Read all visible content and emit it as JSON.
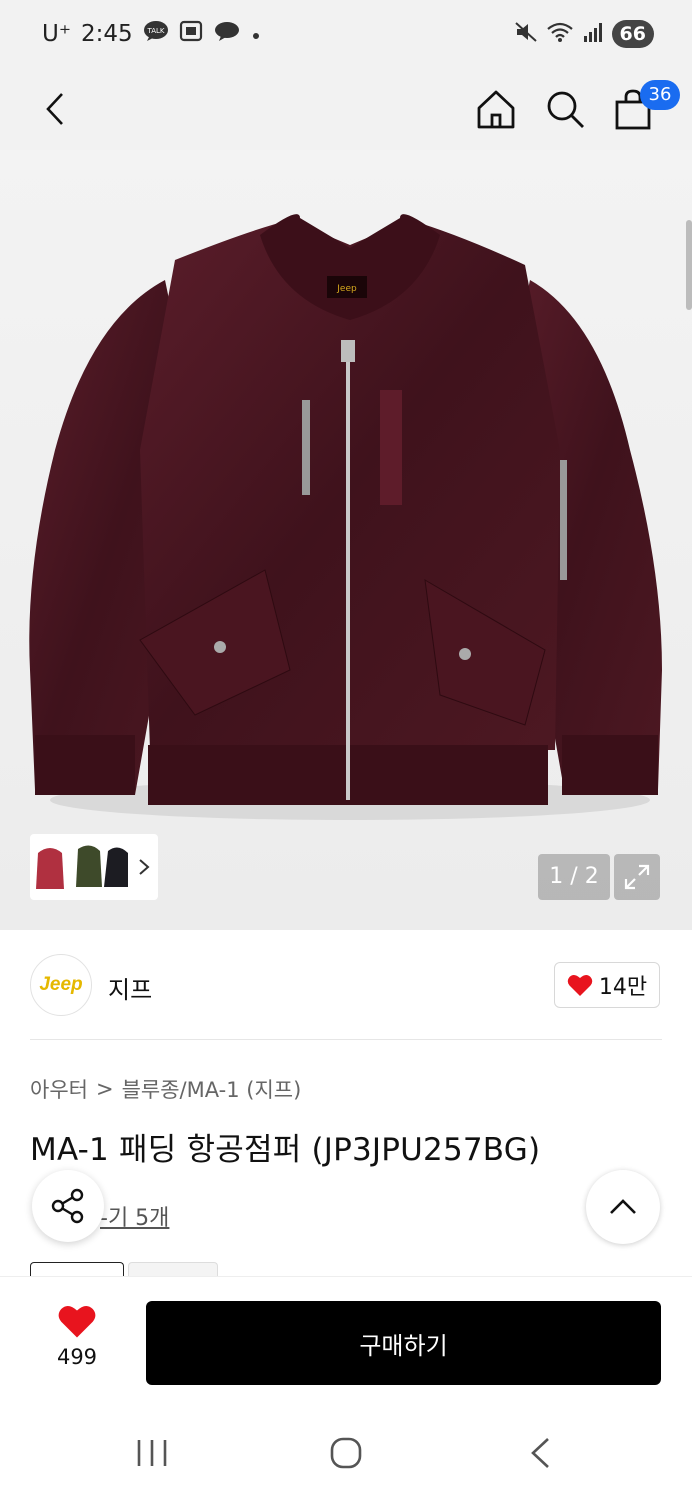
{
  "status_bar": {
    "carrier": "U⁺",
    "time": "2:45",
    "battery": "66"
  },
  "header": {
    "cart_count": "36"
  },
  "gallery": {
    "counter": "1 / 2"
  },
  "brand": {
    "logo_text": "Jeep",
    "name": "지프",
    "like_count": "14만"
  },
  "product": {
    "breadcrumb": [
      "아우터",
      ">",
      "블루종/MA-1 (지프)"
    ],
    "title": "MA-1 패딩 항공점퍼 (JP3JPU257BG)",
    "review_link": "-기 5개"
  },
  "purchase": {
    "wish_count": "499",
    "buy_label": "구매하기"
  },
  "colors": {
    "jacket": "#4a1620",
    "badge": "#1a6cf0",
    "heart": "#e8141e",
    "brand_yellow": "#e5b800"
  }
}
